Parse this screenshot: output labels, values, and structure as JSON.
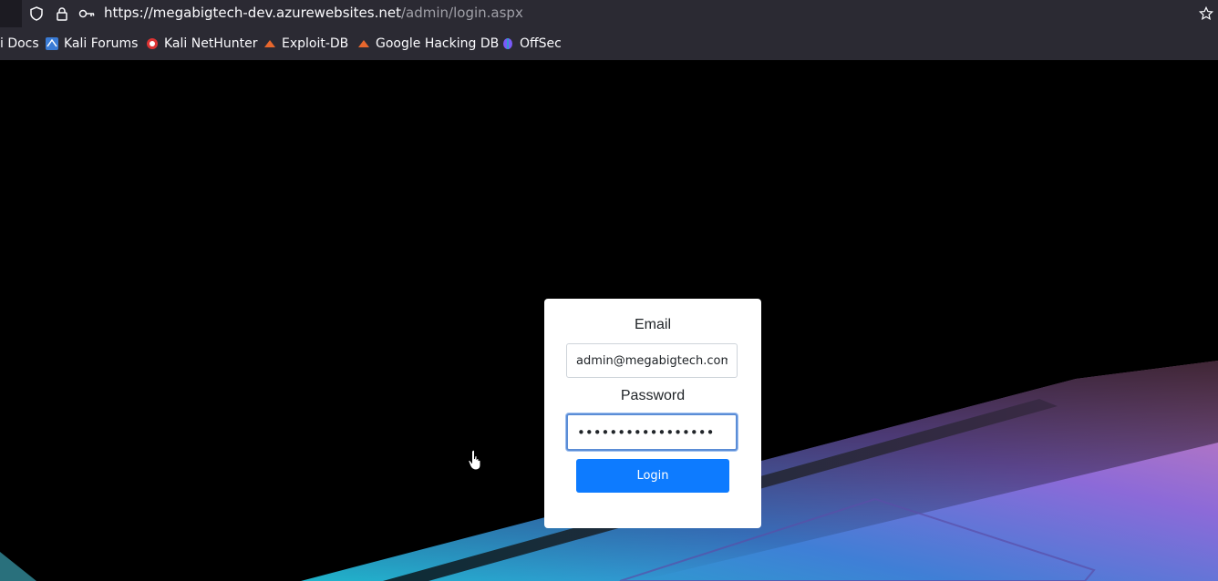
{
  "browser": {
    "url_host": "https://megabigtech-dev.azurewebsites.net",
    "url_path": "/admin/login.aspx",
    "bookmarks": [
      {
        "label": "i Docs",
        "icon": "kali-icon"
      },
      {
        "label": "Kali Forums",
        "icon": "kali-forums-icon"
      },
      {
        "label": "Kali NetHunter",
        "icon": "nethunter-icon"
      },
      {
        "label": "Exploit-DB",
        "icon": "exploitdb-icon"
      },
      {
        "label": "Google Hacking DB",
        "icon": "ghdb-icon"
      },
      {
        "label": "OffSec",
        "icon": "offsec-icon"
      }
    ]
  },
  "login": {
    "email_label": "Email",
    "email_value": "admin@megabigtech.com",
    "password_label": "Password",
    "password_value": "•••••••••••••••••",
    "submit_label": "Login"
  },
  "colors": {
    "button": "#0d7bff",
    "browser_bg": "#2b2a33"
  }
}
